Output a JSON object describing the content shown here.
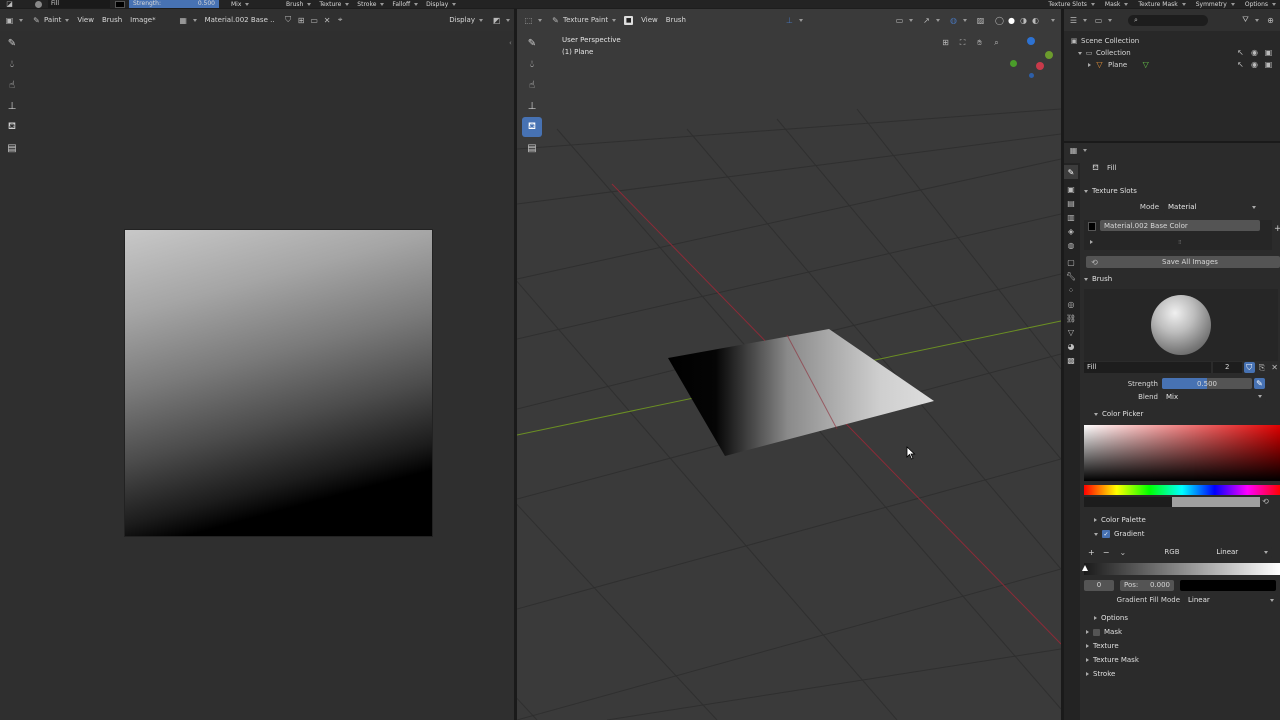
{
  "topbar": {
    "brush_name": "Fill",
    "strength_label": "Strength:",
    "strength_value": "0.500",
    "blend": "Mix",
    "menus_left": [
      "Brush",
      "Texture",
      "Stroke",
      "Falloff",
      "Display"
    ],
    "menus_right": [
      "Texture Slots",
      "Mask",
      "Texture Mask",
      "Symmetry",
      "Options"
    ]
  },
  "image_editor": {
    "mode": "Paint",
    "menus": [
      "View",
      "Brush",
      "Image*"
    ],
    "image_name": "Material.002 Base ...",
    "display": "Display"
  },
  "viewport": {
    "mode": "Texture Paint",
    "menus": [
      "View",
      "Brush"
    ],
    "perspective": "User Perspective",
    "object": "(1) Plane"
  },
  "outliner": {
    "scene_collection": "Scene Collection",
    "collection": "Collection",
    "object": "Plane"
  },
  "properties": {
    "tool_name": "Fill",
    "texture_slots": {
      "title": "Texture Slots",
      "mode_label": "Mode",
      "mode_value": "Material",
      "slot_item": "Material.002 Base Color",
      "save_all": "Save All Images"
    },
    "brush": {
      "title": "Brush",
      "name": "Fill",
      "users": "2",
      "strength_label": "Strength",
      "strength_value": "0.500",
      "strength_fraction": 0.5,
      "blend_label": "Blend",
      "blend_value": "Mix"
    },
    "color_picker_title": "Color Picker",
    "color_palette": "Color Palette",
    "gradient": {
      "title": "Gradient",
      "checked": true,
      "color_mode": "RGB",
      "interpolation": "Linear",
      "index": "0",
      "pos_label": "Pos:",
      "pos_value": "0.000",
      "fill_mode_label": "Gradient Fill Mode",
      "fill_mode_value": "Linear"
    },
    "collapsed_panels": [
      "Options",
      "Mask",
      "Texture",
      "Texture Mask",
      "Stroke"
    ]
  },
  "colors": {
    "accent": "#4772b3",
    "x_axis": "#8e2a37",
    "y_axis": "#6b8f23",
    "active_tool": "#4772b3"
  }
}
